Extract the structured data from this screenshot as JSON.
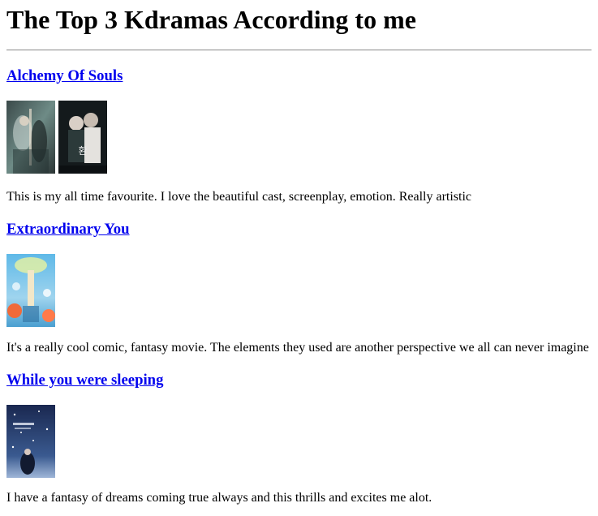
{
  "page": {
    "title": "The Top 3 Kdramas According to me"
  },
  "dramas": [
    {
      "title": "Alchemy Of Souls",
      "description": "This is my all time favourite. I love the beautiful cast, screenplay, emotion. Really artistic",
      "posters": [
        "alchemy-of-souls-poster-1",
        "alchemy-of-souls-poster-2"
      ]
    },
    {
      "title": "Extraordinary You",
      "description": "It's a really cool comic, fantasy movie. The elements they used are another perspective we all can never imagine",
      "posters": [
        "extraordinary-you-poster"
      ]
    },
    {
      "title": "While you were sleeping",
      "description": "I have a fantasy of dreams coming true always and this thrills and excites me alot.",
      "posters": [
        "while-you-were-sleeping-poster"
      ]
    }
  ]
}
